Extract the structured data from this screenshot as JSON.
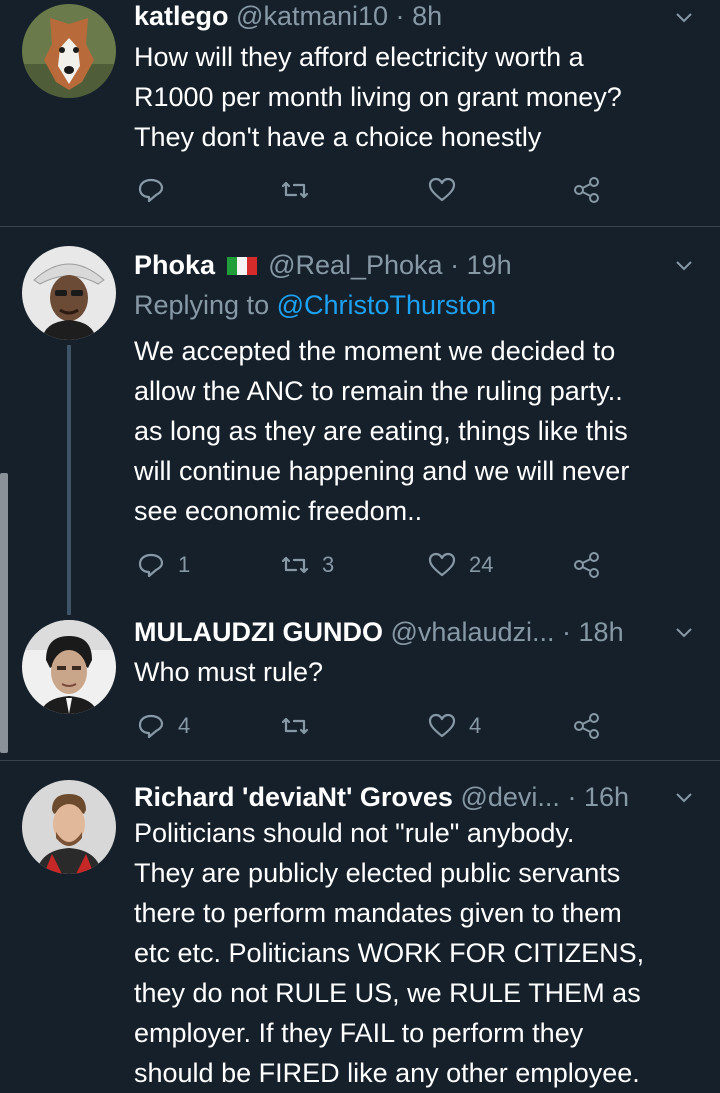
{
  "tweets": [
    {
      "name": "katlego",
      "handle": "@katmani10",
      "dot": "·",
      "time": "8h",
      "body": "How will they afford electricity worth a\nR1000 per month living on grant money?\nThey don't have a choice honestly",
      "counts": {
        "reply": "",
        "retweet": "",
        "like": ""
      }
    },
    {
      "name": "Phoka",
      "handle": "@Real_Phoka",
      "dot": "·",
      "time": "19h",
      "replying_prefix": "Replying to",
      "replying_to": "@ChristoThurston",
      "body": "We accepted the moment we decided to\nallow the ANC to remain the ruling party..\nas long as they are eating, things like this\nwill continue happening and we will never\nsee economic freedom..",
      "counts": {
        "reply": "1",
        "retweet": "3",
        "like": "24"
      }
    },
    {
      "name": "MULAUDZI GUNDO",
      "handle": "@vhalaudzi...",
      "dot": "·",
      "time": "18h",
      "body": "Who must rule?",
      "counts": {
        "reply": "4",
        "retweet": "",
        "like": "4"
      }
    },
    {
      "name": "Richard 'deviaNt' Groves",
      "handle": "@devi...",
      "dot": "·",
      "time": "16h",
      "body": "Politicians should not \"rule\" anybody.\nThey are publicly elected public servants\nthere to perform mandates given to them\netc etc. Politicians WORK FOR CITIZENS,\nthey do not RULE US, we  RULE THEM as\nemployer. If they FAIL to perform they\nshould be FIRED like any other employee."
    }
  ],
  "icons": {
    "reply": "reply-icon",
    "retweet": "retweet-icon",
    "like": "heart-icon",
    "share": "share-icon",
    "menu": "chevron-down-icon",
    "flag": "italy-flag-icon"
  },
  "colors": {
    "background": "#15202b",
    "muted": "#8899a6",
    "link": "#1da1f2",
    "divider": "#38444d"
  }
}
